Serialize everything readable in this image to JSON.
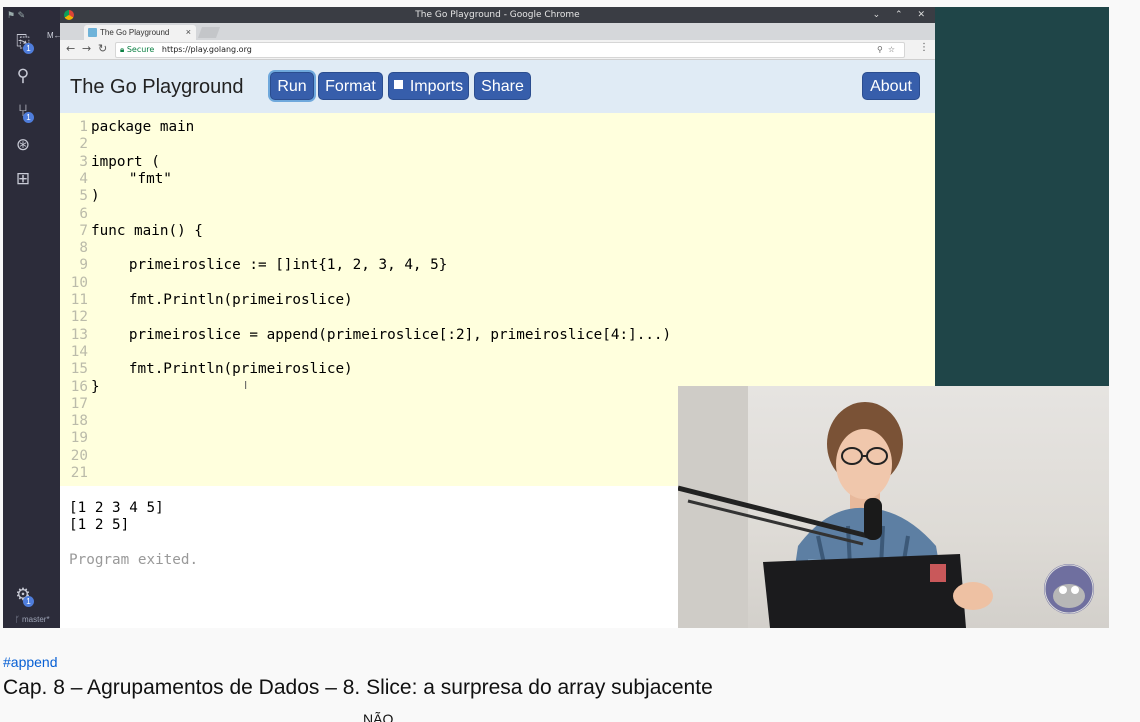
{
  "vscode": {
    "top_icons": "⚑ ✎",
    "tab_fragment": "M←",
    "activity_icons": [
      "files-icon",
      "search-icon",
      "source-control-icon",
      "debug-icon",
      "extensions-icon",
      "gear-icon"
    ],
    "badges": {
      "files": "1",
      "source_control": "1",
      "settings": "1"
    },
    "branch": "ᚴ master*"
  },
  "browser": {
    "window_title": "The Go Playground - Google Chrome",
    "window_controls": "⌄ ⌃ ✕",
    "tab_title": "The Go Playground",
    "tab_close": "×",
    "secure_label": "Secure",
    "url": "https://play.golang.org"
  },
  "playground": {
    "title": "The Go Playground",
    "buttons": {
      "run": "Run",
      "format": "Format",
      "imports": "Imports",
      "share": "Share",
      "about": "About"
    },
    "imports_checked": false,
    "code_lines": [
      "package main",
      "",
      "import (",
      "\t\"fmt\"",
      ")",
      "",
      "func main() {",
      "",
      "\tprimeiroslice := []int{1, 2, 3, 4, 5}",
      "",
      "\tfmt.Println(primeiroslice)",
      "",
      "\tprimeiroslice = append(primeiroslice[:2], primeiroslice[4:]...)",
      "",
      "\tfmt.Println(primeiroslice)",
      "}",
      "",
      "",
      "",
      "",
      ""
    ],
    "output_lines": [
      "[1 2 3 4 5]",
      "[1 2 5]"
    ],
    "exit_message": "Program exited."
  },
  "video": {
    "hashtag": "#append",
    "title": "Cap. 8 – Agrupamentos de Dados – 8. Slice: a surpresa do array subjacente",
    "below_fragment": "NÃO"
  },
  "colors": {
    "accent_button": "#375eab",
    "header_bg": "#e0ebf5",
    "editor_bg": "#ffffdd",
    "desktop_bg": "#1f4548",
    "link": "#065fd4"
  }
}
